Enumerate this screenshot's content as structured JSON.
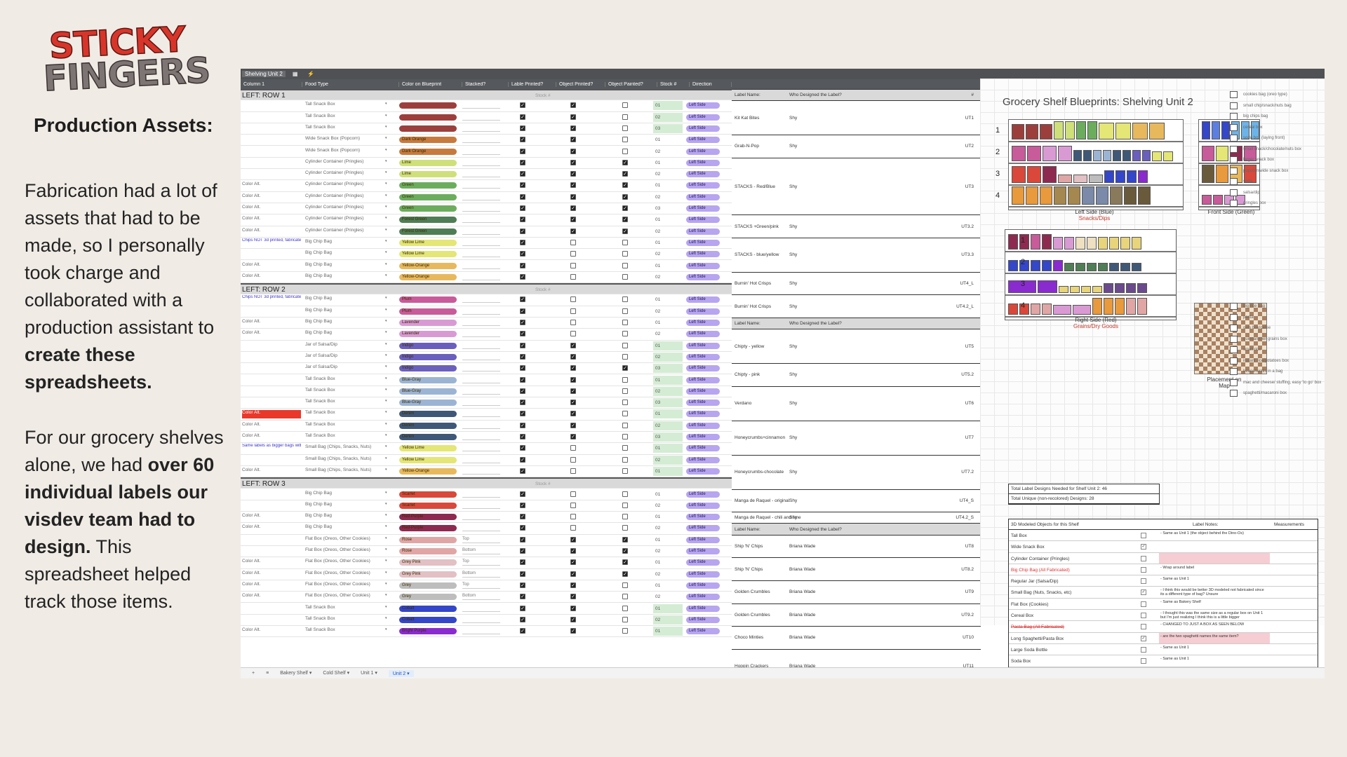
{
  "logo": {
    "line1": "STICKY",
    "line2": "FINGERS"
  },
  "title": "Production Assets:",
  "para1": {
    "t1": "Fabrication had a lot of assets that had to be made, so I personally took charge and collaborated with a production assistant to ",
    "b1": "create these spreadsheets."
  },
  "para2": {
    "t1": "For our grocery shelves alone, we had ",
    "b1": "over 60 individual labels our visdev team had to design.",
    "t2": " This spreadsheet helped track those items."
  },
  "sheet": {
    "tab_name": "Shelving Unit 2",
    "headers": [
      "Column 1",
      "Food Type",
      "Color on Blueprint",
      "Stacked?",
      "Lable Printed?",
      "Object Printed?",
      "Object Painted?",
      "Stock #",
      "Direction"
    ],
    "sections": {
      "row1": "LEFT: ROW 1",
      "row2": "LEFT: ROW 2",
      "row3": "LEFT: ROW 3"
    },
    "label_headers": {
      "name": "Label Name:",
      "who": "Who Designed the Label?",
      "code": "#"
    },
    "stock_placeholder": "Stock #",
    "rows": [
      {
        "sec": "row1"
      },
      {
        "col1": "",
        "food": "Tall Snack Box",
        "color": "#9c3f3c",
        "cname": "",
        "stock": "01",
        "st": "g",
        "c1": 1,
        "c2": 1,
        "c3": 0
      },
      {
        "col1": "",
        "food": "Tall Snack Box",
        "color": "#9c3f3c",
        "cname": "",
        "stock": "02",
        "st": "g",
        "c1": 1,
        "c2": 1,
        "c3": 0
      },
      {
        "col1": "",
        "food": "Tall Snack Box",
        "color": "#9c3f3c",
        "cname": "",
        "stock": "03",
        "st": "g",
        "c1": 1,
        "c2": 1,
        "c3": 0
      },
      {
        "col1": "",
        "food": "Wide Snack Box (Popcorn)",
        "color": "#c77a3d",
        "cname": "Dark Orange",
        "stock": "01",
        "st": "",
        "c1": 1,
        "c2": 1,
        "c3": 0
      },
      {
        "col1": "",
        "food": "Wide Snack Box (Popcorn)",
        "color": "#c77a3d",
        "cname": "Dark Orange",
        "stock": "02",
        "st": "",
        "c1": 1,
        "c2": 1,
        "c3": 0
      },
      {
        "col1": "",
        "food": "Cylinder Container (Pringles)",
        "color": "#cfe07a",
        "cname": "Lime",
        "stock": "01",
        "st": "",
        "c1": 1,
        "c2": 1,
        "c3": 1
      },
      {
        "col1": "",
        "food": "Cylinder Container (Pringles)",
        "color": "#cfe07a",
        "cname": "Lime",
        "stock": "02",
        "st": "",
        "c1": 1,
        "c2": 1,
        "c3": 1
      },
      {
        "col1": "Color Alt.",
        "food": "Cylinder Container (Pringles)",
        "color": "#6cad5d",
        "cname": "Green",
        "stock": "01",
        "st": "",
        "c1": 1,
        "c2": 1,
        "c3": 1
      },
      {
        "col1": "Color Alt.",
        "food": "Cylinder Container (Pringles)",
        "color": "#6cad5d",
        "cname": "Green",
        "stock": "02",
        "st": "",
        "c1": 1,
        "c2": 1,
        "c3": 1
      },
      {
        "col1": "Color Alt.",
        "food": "Cylinder Container (Pringles)",
        "color": "#6cad5d",
        "cname": "Green",
        "stock": "03",
        "st": "",
        "c1": 1,
        "c2": 1,
        "c3": 1
      },
      {
        "col1": "Color Alt.",
        "food": "Cylinder Container (Pringles)",
        "color": "#4f7d55",
        "cname": "Forest Green",
        "stock": "01",
        "st": "",
        "c1": 1,
        "c2": 1,
        "c3": 1
      },
      {
        "col1": "Color Alt.",
        "food": "Cylinder Container (Pringles)",
        "color": "#4f7d55",
        "cname": "Forest Green",
        "stock": "02",
        "st": "",
        "c1": 1,
        "c2": 1,
        "c3": 1
      },
      {
        "col1": "Chips NOT 3d printed, fabricated instead",
        "note": 1,
        "food": "Big Chip Bag",
        "color": "#e4e676",
        "cname": "Yellow Lime",
        "stock": "01",
        "st": "",
        "c1": 1,
        "c2": 0,
        "c3": 0
      },
      {
        "col1": "",
        "food": "Big Chip Bag",
        "color": "#e4e676",
        "cname": "Yellow Lime",
        "stock": "02",
        "st": "",
        "c1": 1,
        "c2": 0,
        "c3": 0
      },
      {
        "col1": "Color Alt.",
        "food": "Big Chip Bag",
        "color": "#e8b95c",
        "cname": "Yellow-Orange",
        "stock": "01",
        "st": "",
        "c1": 1,
        "c2": 0,
        "c3": 0
      },
      {
        "col1": "Color Alt.",
        "food": "Big Chip Bag",
        "color": "#e8b95c",
        "cname": "Yellow-Orange",
        "stock": "02",
        "st": "",
        "c1": 1,
        "c2": 0,
        "c3": 0
      },
      {
        "sec": "row2"
      },
      {
        "col1": "Chips NOT 3d printed, fabricated instead",
        "note": 1,
        "food": "Big Chip Bag",
        "color": "#c85b9a",
        "cname": "Plum",
        "stock": "01",
        "st": "",
        "c1": 1,
        "c2": 0,
        "c3": 0
      },
      {
        "col1": "",
        "food": "Big Chip Bag",
        "color": "#c85b9a",
        "cname": "Plum",
        "stock": "02",
        "st": "",
        "c1": 1,
        "c2": 0,
        "c3": 0
      },
      {
        "col1": "Color Alt.",
        "food": "Big Chip Bag",
        "color": "#d99ad4",
        "cname": "Lavender",
        "stock": "01",
        "st": "",
        "c1": 1,
        "c2": 0,
        "c3": 0
      },
      {
        "col1": "Color Alt.",
        "food": "Big Chip Bag",
        "color": "#d99ad4",
        "cname": "Lavender",
        "stock": "02",
        "st": "",
        "c1": 1,
        "c2": 0,
        "c3": 0
      },
      {
        "col1": "",
        "food": "Jar of Salsa/Dip",
        "color": "#6b5fbe",
        "cname": "Indigo",
        "stock": "01",
        "st": "g",
        "c1": 1,
        "c2": 1,
        "c3": 0
      },
      {
        "col1": "",
        "food": "Jar of Salsa/Dip",
        "color": "#6b5fbe",
        "cname": "Indigo",
        "stock": "02",
        "st": "g",
        "c1": 1,
        "c2": 1,
        "c3": 0
      },
      {
        "col1": "",
        "food": "Jar of Salsa/Dip",
        "color": "#6b5fbe",
        "cname": "Indigo",
        "stock": "03",
        "st": "g",
        "c1": 1,
        "c2": 1,
        "c3": 1
      },
      {
        "col1": "",
        "food": "Tall Snack Box",
        "color": "#9cb4d4",
        "cname": "Blue-Gray",
        "stock": "01",
        "st": "g",
        "c1": 1,
        "c2": 1,
        "c3": 0
      },
      {
        "col1": "",
        "food": "Tall Snack Box",
        "color": "#9cb4d4",
        "cname": "Blue-Gray",
        "stock": "02",
        "st": "g",
        "c1": 1,
        "c2": 1,
        "c3": 0
      },
      {
        "col1": "",
        "food": "Tall Snack Box",
        "color": "#9cb4d4",
        "cname": "Blue-Gray",
        "stock": "03",
        "st": "g",
        "c1": 1,
        "c2": 1,
        "c3": 0
      },
      {
        "col1": "Color Alt.",
        "red": 1,
        "food": "Tall Snack Box",
        "color": "#3f5878",
        "cname": "Denim",
        "stock": "01",
        "st": "g",
        "c1": 1,
        "c2": 1,
        "c3": 0
      },
      {
        "col1": "Color Alt.",
        "food": "Tall Snack Box",
        "color": "#3f5878",
        "cname": "Denim",
        "stock": "02",
        "st": "g",
        "c1": 1,
        "c2": 1,
        "c3": 0
      },
      {
        "col1": "Color Alt.",
        "food": "Tall Snack Box",
        "color": "#3f5878",
        "cname": "Denim",
        "stock": "03",
        "st": "g",
        "c1": 1,
        "c2": 1,
        "c3": 0
      },
      {
        "col1": "Same labels as bigger bags with same color, just different size",
        "note": 1,
        "food": "Small Bag (Chips, Snacks, Nuts)",
        "color": "#e4e676",
        "cname": "Yellow Lime",
        "stock": "01",
        "st": "g",
        "c1": 1,
        "c2": 0,
        "c3": 0
      },
      {
        "col1": "",
        "food": "Small Bag (Chips, Snacks, Nuts)",
        "color": "#e4e676",
        "cname": "Yellow Lime",
        "stock": "02",
        "st": "g",
        "c1": 1,
        "c2": 0,
        "c3": 0
      },
      {
        "col1": "Color Alt.",
        "food": "Small Bag (Chips, Snacks, Nuts)",
        "color": "#e8b95c",
        "cname": "Yellow-Orange",
        "stock": "01",
        "st": "g",
        "c1": 1,
        "c2": 0,
        "c3": 0
      },
      {
        "sec": "row3"
      },
      {
        "col1": "",
        "food": "Big Chip Bag",
        "color": "#d9483a",
        "cname": "Scarlet",
        "stock": "01",
        "st": "",
        "c1": 1,
        "c2": 0,
        "c3": 0
      },
      {
        "col1": "",
        "food": "Big Chip Bag",
        "color": "#d9483a",
        "cname": "Scarlet",
        "stock": "02",
        "st": "",
        "c1": 1,
        "c2": 0,
        "c3": 0
      },
      {
        "col1": "Color Alt.",
        "food": "Big Chip Bag",
        "color": "#8e2a50",
        "cname": "Red-Purple",
        "stock": "01",
        "st": "",
        "c1": 1,
        "c2": 0,
        "c3": 0
      },
      {
        "col1": "Color Alt.",
        "food": "Big Chip Bag",
        "color": "#8e2a50",
        "cname": "Red-Purple",
        "stock": "02",
        "st": "",
        "c1": 1,
        "c2": 0,
        "c3": 0
      },
      {
        "col1": "",
        "food": "Flat Box (Oreos, Other Cookies)",
        "color": "#e0a6a6",
        "cname": "Rose",
        "stock": "01",
        "st": "",
        "c1": 1,
        "c2": 1,
        "c3": 1,
        "stack": "Top"
      },
      {
        "col1": "",
        "food": "Flat Box (Oreos, Other Cookies)",
        "color": "#e0a6a6",
        "cname": "Rose",
        "stock": "02",
        "st": "",
        "c1": 1,
        "c2": 1,
        "c3": 1,
        "stack": "Bottom"
      },
      {
        "col1": "Color Alt.",
        "food": "Flat Box (Oreos, Other Cookies)",
        "color": "#e2c0c4",
        "cname": "Grey Pink",
        "stock": "01",
        "st": "",
        "c1": 1,
        "c2": 1,
        "c3": 1,
        "stack": "Top"
      },
      {
        "col1": "Color Alt.",
        "food": "Flat Box (Oreos, Other Cookies)",
        "color": "#e2c0c4",
        "cname": "Grey Pink",
        "stock": "02",
        "st": "",
        "c1": 1,
        "c2": 1,
        "c3": 1,
        "stack": "Bottom"
      },
      {
        "col1": "Color Alt.",
        "food": "Flat Box (Oreos, Other Cookies)",
        "color": "#bdbdbd",
        "cname": "Grey",
        "stock": "01",
        "st": "",
        "c1": 1,
        "c2": 1,
        "c3": 0,
        "stack": "Top"
      },
      {
        "col1": "Color Alt.",
        "food": "Flat Box (Oreos, Other Cookies)",
        "color": "#bdbdbd",
        "cname": "Grey",
        "stock": "02",
        "st": "",
        "c1": 1,
        "c2": 1,
        "c3": 0,
        "stack": "Bottom"
      },
      {
        "col1": "",
        "food": "Tall Snack Box",
        "color": "#3446c9",
        "cname": "Cobalt",
        "stock": "01",
        "st": "g",
        "c1": 1,
        "c2": 1,
        "c3": 0
      },
      {
        "col1": "",
        "food": "Tall Snack Box",
        "color": "#3446c9",
        "cname": "Cobalt",
        "stock": "02",
        "st": "g",
        "c1": 1,
        "c2": 1,
        "c3": 0
      },
      {
        "col1": "Color Alt.",
        "food": "Tall Snack Box",
        "color": "#8a2bd0",
        "cname": "Bright Purple",
        "stock": "01",
        "st": "g",
        "c1": 1,
        "c2": 1,
        "c3": 0
      }
    ],
    "direction_label": "Left Side",
    "labels": [
      {
        "name": "Label Name:",
        "who": "Who Designed the Label?",
        "code": "#",
        "hdr": 1
      },
      {
        "name": "Kit Kat Bites",
        "who": "Shy",
        "code": "UT1"
      },
      {
        "name": "Grab-N-Pop",
        "who": "Shy",
        "code": "UT2"
      },
      {
        "name": "STACKS - Red/Blue",
        "who": "Shy",
        "code": "UT3"
      },
      {
        "name": "STACKS +Green/pink",
        "who": "Shy",
        "code": "UT3.2"
      },
      {
        "name": "STACKS - blue/yellow",
        "who": "Shy",
        "code": "UT3.3"
      },
      {
        "name": "Burnin' Hot Crisps",
        "who": "Shy",
        "code": "UT4_L"
      },
      {
        "name": "Burnin' Hot Crisps",
        "who": "Shy",
        "code": "UT4.2_L"
      },
      {
        "name": "Label Name:",
        "who": "Who Designed the Label?",
        "code": "",
        "hdr": 1
      },
      {
        "name": "Chipty - yellow",
        "who": "Shy",
        "code": "UT5"
      },
      {
        "name": "Chipty - pink",
        "who": "Shy",
        "code": "UT5.2"
      },
      {
        "name": "Verdano",
        "who": "Shy",
        "code": "UT6"
      },
      {
        "name": "Honeycrumbs+cinnamon",
        "who": "Shy",
        "code": "UT7"
      },
      {
        "name": "Honeycrumbs-chocolate",
        "who": "Shy",
        "code": "UT7.2"
      },
      {
        "name": "Manga de Raquel - original",
        "who": "Shy",
        "code": "UT4_S"
      },
      {
        "name": "Manga de Raquel - chili and lime",
        "who": "Shy",
        "code": "UT4.2_S"
      },
      {
        "name": "Label Name:",
        "who": "Who Designed the Label?",
        "code": "",
        "hdr": 1
      },
      {
        "name": "Ship 'N' Chips",
        "who": "Briana Wade",
        "code": "UT8"
      },
      {
        "name": "Ship 'N' Chips",
        "who": "Briana Wade",
        "code": "UT8.2"
      },
      {
        "name": "Golden Crumbles",
        "who": "Briana Wade",
        "code": "UT9"
      },
      {
        "name": "Golden Crumbles",
        "who": "Briana Wade",
        "code": "UT9.2"
      },
      {
        "name": "Choco Minties",
        "who": "Briana Wade",
        "code": "UT10"
      },
      {
        "name": "Hoppin Crackers",
        "who": "Briana Wade",
        "code": "UT11"
      }
    ]
  },
  "blueprint": {
    "title": "Grocery Shelf Blueprints: Shelving Unit 2",
    "left_side": "Left Side (Blue)",
    "left_sub": "Snacks/Dips",
    "front_side": "Front Side (Green)",
    "right_side": "Right Side (Red)",
    "right_sub": "Grains/Dry Goods",
    "placement": "Placement on Map",
    "row_numbers": [
      "1",
      "2",
      "3",
      "4"
    ],
    "legend_top": [
      "cookies bag (oreo type)",
      "small chip/snack/nuts bag",
      "big chips bag",
      "cereal box",
      "soda box (laying front)",
      "small snack/chocolate/nuts box",
      "larger snack box",
      "popcorn/wide snack box",
      "soda",
      "salsa/dip",
      "pringles box"
    ],
    "legend_bottom": [
      "big rice bag",
      "pasta",
      "oats box/cafee",
      "quinoa/other grains box",
      "small rice",
      "instant rice/potatoes box",
      "beans/lentils in a bag",
      "mac and cheese/ stuffing, easy 'to go' box",
      "spaghetti/macaroni box"
    ]
  },
  "totals": {
    "a": "Total Label Designs Needed for Shelf Unit 2: 46",
    "b": "Total Unique (non-recolored) Designs: 28"
  },
  "objects": {
    "header": "3D Modeled Objects for this Shelf",
    "notes_header": "Label Notes:",
    "meas_header": "Measurements",
    "items": [
      {
        "name": "Tall Box",
        "note": "- Same as Unit 1 (the object behind the Dino-Os)",
        "ck": 0
      },
      {
        "name": "Wide Snack Box",
        "note": "",
        "ck": 1
      },
      {
        "name": "Cylinder Container (Pringles)",
        "note": "",
        "ck": 0,
        "pink": 1
      },
      {
        "name": "Big Chip Bag (All Fabricated)",
        "note": "- Wrap around label",
        "ck": 0,
        "red": 1
      },
      {
        "name": "Regular Jar (Salsa/Dip)",
        "note": "- Same as Unit 1",
        "ck": 0
      },
      {
        "name": "Small Bag (Nuts, Snacks, etc)",
        "note": "- I think this would be better 3D modeled not fabricated since its a different type of bag? Unsure",
        "ck": 1
      },
      {
        "name": "Flat Box (Cookies)",
        "note": "- Same as Bakery Shelf",
        "ck": 0
      },
      {
        "name": "Cereal Box",
        "note": "- I thought this was the same size as a regular box on Unit 1 but I'm just realizing I think this is a little bigger",
        "ck": 0
      },
      {
        "name": "Pasta Bag (All Fabricated)",
        "note": "- CHANGED TO JUST A BOX AS SEEN BELOW",
        "ck": 0,
        "red": 1,
        "strike": 1
      },
      {
        "name": "Long Spaghetti/Pasta Box",
        "note": "- are the two spaghetti names the same item?",
        "ck": 1,
        "pink": 1
      },
      {
        "name": "Large Soda Bottle",
        "note": "- Same as Unit 1",
        "ck": 0
      },
      {
        "name": "Soda Box",
        "note": "- Same as Unit 1",
        "ck": 0
      }
    ]
  },
  "bottom_tabs": [
    "Bakery Shelf",
    "Cold Shelf",
    "Unit 1",
    "Unit 2"
  ],
  "active_tab": "Unit 2"
}
